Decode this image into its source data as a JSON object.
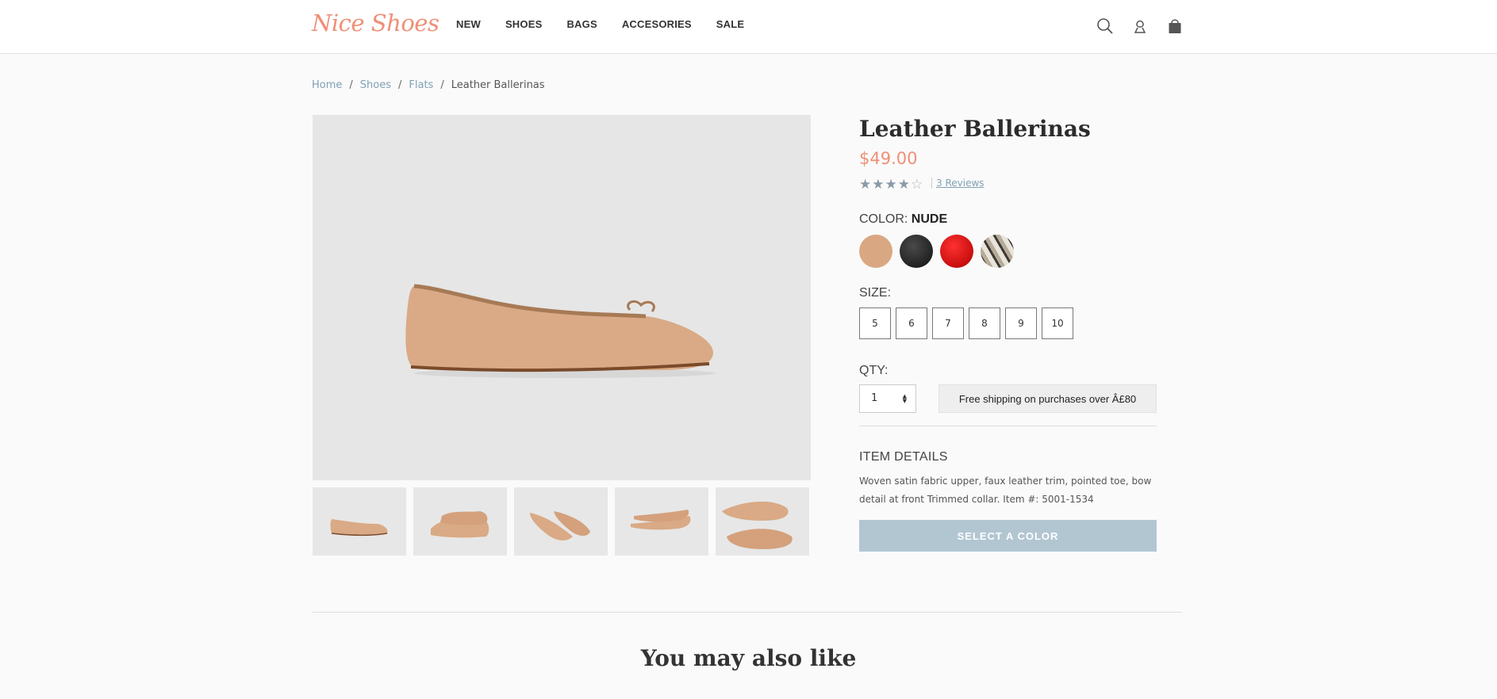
{
  "brand": {
    "logo": "Nice Shoes",
    "accent": "#ef8f77"
  },
  "nav": {
    "items": [
      "NEW",
      "SHOES",
      "BAGS",
      "ACCESORIES",
      "SALE"
    ]
  },
  "header_icons": [
    "search-icon",
    "user-icon",
    "cart-icon"
  ],
  "breadcrumb": {
    "items": [
      "Home",
      "Shoes",
      "Flats"
    ],
    "separator": "/",
    "current": "Leather Ballerinas"
  },
  "product": {
    "title": "Leather Ballerinas",
    "price": "$49.00",
    "rating": 4,
    "rating_max": 5,
    "reviews_label": "3 Reviews",
    "color_label": "COLOR:",
    "color_value": "NUDE",
    "swatches": [
      {
        "name": "nude",
        "color": "#d9a882"
      },
      {
        "name": "black",
        "color": "#1f1f1f"
      },
      {
        "name": "red",
        "color": "#d10d0d"
      },
      {
        "name": "snake",
        "color": "#9a9284"
      }
    ],
    "size_label": "SIZE:",
    "sizes": [
      "5",
      "6",
      "7",
      "8",
      "9",
      "10"
    ],
    "qty_label": "QTY:",
    "qty_value": "1",
    "shipping_note": "Free shipping on purchases over Â£80",
    "details_heading": "ITEM DETAILS",
    "details_text": "Woven satin fabric upper, faux leather trim, pointed toe, bow detail at front Trimmed collar. Item #: 5001-1534",
    "cta_label": "SELECT A COLOR",
    "cta_color": "#b2c6d2"
  },
  "recommendations": {
    "heading": "You may also like"
  }
}
